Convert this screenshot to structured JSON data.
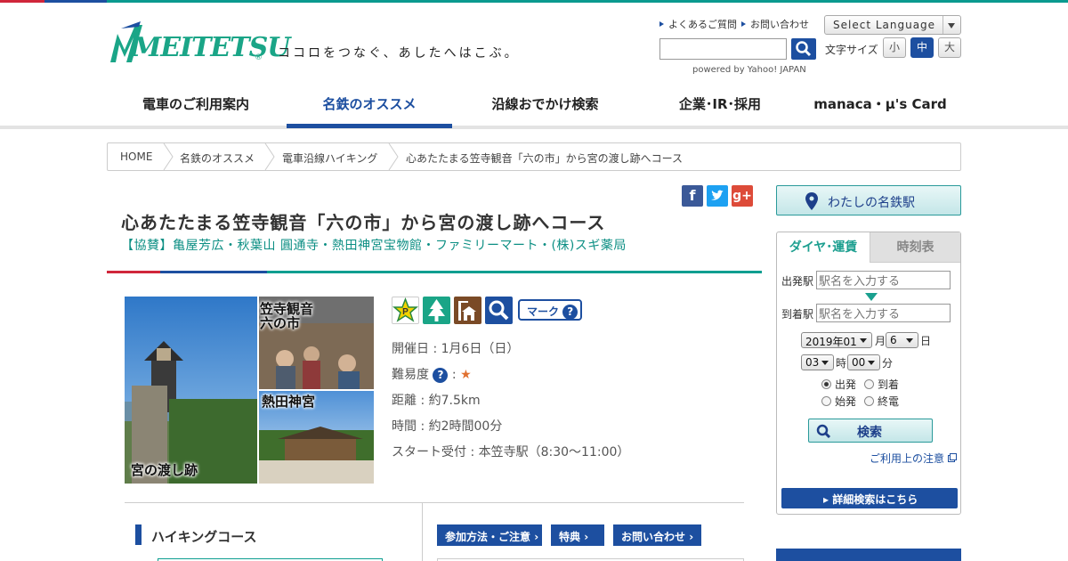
{
  "header": {
    "brand": "MEITETSU",
    "tagline": "ココロをつなぐ、あしたへはこぶ。",
    "util_links": [
      "よくあるご質問",
      "お問い合わせ"
    ],
    "language_select": "Select Language",
    "search_value": "",
    "powered_by": "powered by Yahoo! JAPAN",
    "font_size_label": "文字サイズ",
    "font_sizes": [
      "小",
      "中",
      "大"
    ],
    "font_size_selected": "中"
  },
  "nav": {
    "items": [
      "電車のご利用案内",
      "名鉄のオススメ",
      "沿線おでかけ検索",
      "企業･IR･採用",
      "manaca・μ's Card"
    ],
    "active": "名鉄のオススメ"
  },
  "breadcrumb": [
    "HOME",
    "名鉄のオススメ",
    "電車沿線ハイキング",
    "心あたたまる笠寺観音「六の市」から宮の渡し跡へコース"
  ],
  "article": {
    "title": "心あたたまる笠寺観音「六の市」から宮の渡し跡へコース",
    "sponsor": "【協賛】亀屋芳広・秋葉山 圓通寺・熱田神宮宝物館・ファミリーマート・(株)スギ薬局",
    "photo_labels": [
      "笠寺観音\n六の市",
      "熱田神宮",
      "宮の渡し跡"
    ],
    "social_icons": [
      "facebook-icon",
      "twitter-icon",
      "google-plus-icon"
    ],
    "feature_icons": [
      "parking-icon",
      "forest-icon",
      "restroom-icon",
      "search-icon"
    ],
    "mark_button": "マーク",
    "info": {
      "date": "開催日 : 1月6日（日）",
      "difficulty_label": "難易度",
      "difficulty_stars": "★",
      "distance": "距離 : 約7.5km",
      "duration": "時間 : 約2時間00分",
      "start": "スタート受付 : 本笠寺駅（8:30～11:00）"
    },
    "section_heading": "ハイキングコース",
    "tabs": [
      "参加方法・ご注意",
      "特典",
      "お問い合わせ"
    ]
  },
  "sidebar": {
    "my_station": "わたしの名鉄駅",
    "dia": {
      "tabs": [
        "ダイヤ･運賃",
        "時刻表"
      ],
      "from_label": "出発駅",
      "from_placeholder": "駅名を入力する",
      "to_label": "到着駅",
      "to_placeholder": "駅名を入力する",
      "year_month": "2019年01",
      "month_unit": "月",
      "day": "6",
      "day_unit": "日",
      "hour": "03",
      "hour_unit": "時",
      "minute": "00",
      "minute_unit": "分",
      "radio": [
        "出発",
        "到着",
        "始発",
        "終電"
      ],
      "radio_selected": "出発",
      "search_button": "検索",
      "note_link": "ご利用上の注意",
      "detail_button": "詳細検索はこちら"
    }
  },
  "colors": {
    "brand_green": "#1aa587",
    "navy": "#1d4fa0",
    "teal": "#0d9e90",
    "red": "#d0263b"
  }
}
